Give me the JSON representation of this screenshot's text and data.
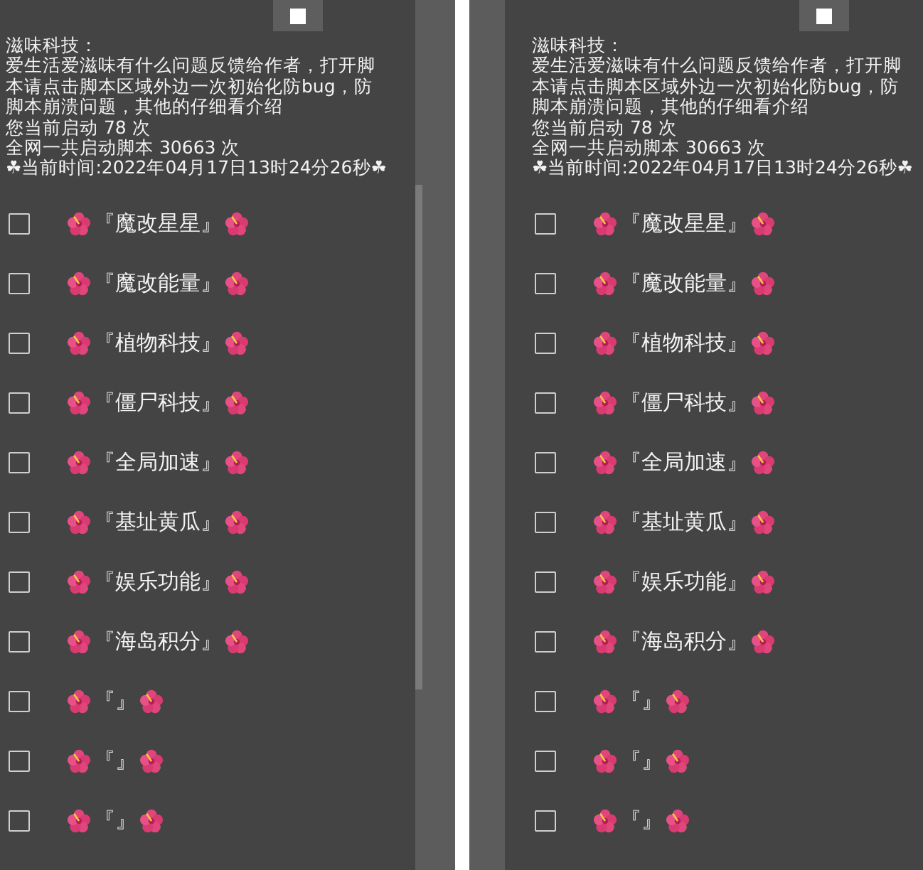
{
  "panels": [
    {
      "info_lines": [
        "滋味科技：",
        "爱生活爱滋味有什么问题反馈给作者，打开脚本请点击脚本区域外边一次初始化防bug，防脚本崩溃问题，其他的仔细看介绍",
        "您当前启动 78 次",
        "全网一共启动脚本 30663 次",
        "☘当前时间:2022年04月17日13时24分26秒☘"
      ],
      "options": [
        {
          "label": "『魔改星星』",
          "checked": false
        },
        {
          "label": "『魔改能量』",
          "checked": false
        },
        {
          "label": "『植物科技』",
          "checked": false
        },
        {
          "label": "『僵尸科技』",
          "checked": false
        },
        {
          "label": "『全局加速』",
          "checked": false
        },
        {
          "label": "『基址黄瓜』",
          "checked": false
        },
        {
          "label": "『娱乐功能』",
          "checked": false
        },
        {
          "label": "『海岛积分』",
          "checked": false
        },
        {
          "label": "『』",
          "checked": false
        },
        {
          "label": "『』",
          "checked": false
        },
        {
          "label": "『』",
          "checked": false
        }
      ]
    },
    {
      "info_lines": [
        "滋味科技：",
        "爱生活爱滋味有什么问题反馈给作者，打开脚本请点击脚本区域外边一次初始化防bug，防脚本崩溃问题，其他的仔细看介绍",
        "您当前启动 78 次",
        "全网一共启动脚本 30663 次",
        "☘当前时间:2022年04月17日13时24分26秒☘"
      ],
      "options": [
        {
          "label": "『魔改星星』",
          "checked": false
        },
        {
          "label": "『魔改能量』",
          "checked": false
        },
        {
          "label": "『植物科技』",
          "checked": false
        },
        {
          "label": "『僵尸科技』",
          "checked": false
        },
        {
          "label": "『全局加速』",
          "checked": false
        },
        {
          "label": "『基址黄瓜』",
          "checked": false
        },
        {
          "label": "『娱乐功能』",
          "checked": false
        },
        {
          "label": "『海岛积分』",
          "checked": false
        },
        {
          "label": "『』",
          "checked": false
        },
        {
          "label": "『』",
          "checked": false
        },
        {
          "label": "『』",
          "checked": false
        }
      ]
    }
  ]
}
